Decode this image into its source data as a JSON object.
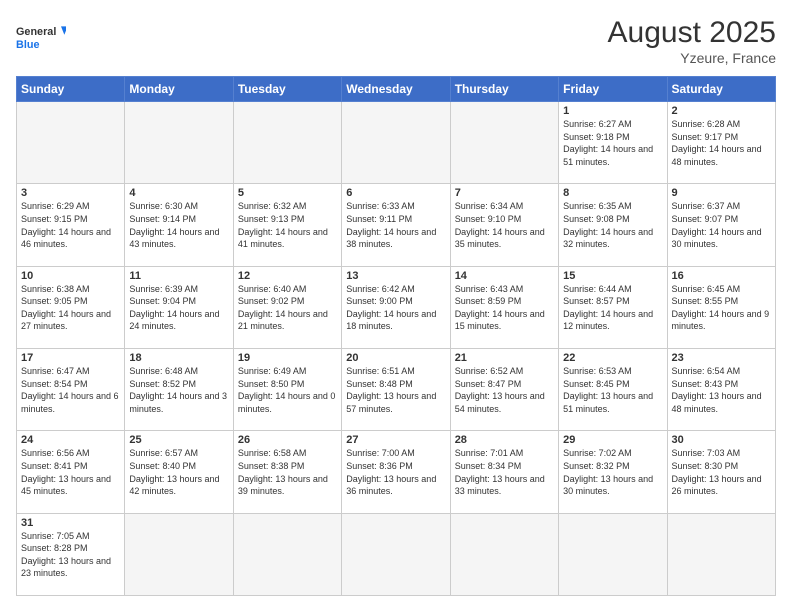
{
  "logo": {
    "text_general": "General",
    "text_blue": "Blue"
  },
  "header": {
    "title": "August 2025",
    "subtitle": "Yzeure, France"
  },
  "days_of_week": [
    "Sunday",
    "Monday",
    "Tuesday",
    "Wednesday",
    "Thursday",
    "Friday",
    "Saturday"
  ],
  "weeks": [
    [
      {
        "day": "",
        "info": ""
      },
      {
        "day": "",
        "info": ""
      },
      {
        "day": "",
        "info": ""
      },
      {
        "day": "",
        "info": ""
      },
      {
        "day": "",
        "info": ""
      },
      {
        "day": "1",
        "info": "Sunrise: 6:27 AM\nSunset: 9:18 PM\nDaylight: 14 hours and 51 minutes."
      },
      {
        "day": "2",
        "info": "Sunrise: 6:28 AM\nSunset: 9:17 PM\nDaylight: 14 hours and 48 minutes."
      }
    ],
    [
      {
        "day": "3",
        "info": "Sunrise: 6:29 AM\nSunset: 9:15 PM\nDaylight: 14 hours and 46 minutes."
      },
      {
        "day": "4",
        "info": "Sunrise: 6:30 AM\nSunset: 9:14 PM\nDaylight: 14 hours and 43 minutes."
      },
      {
        "day": "5",
        "info": "Sunrise: 6:32 AM\nSunset: 9:13 PM\nDaylight: 14 hours and 41 minutes."
      },
      {
        "day": "6",
        "info": "Sunrise: 6:33 AM\nSunset: 9:11 PM\nDaylight: 14 hours and 38 minutes."
      },
      {
        "day": "7",
        "info": "Sunrise: 6:34 AM\nSunset: 9:10 PM\nDaylight: 14 hours and 35 minutes."
      },
      {
        "day": "8",
        "info": "Sunrise: 6:35 AM\nSunset: 9:08 PM\nDaylight: 14 hours and 32 minutes."
      },
      {
        "day": "9",
        "info": "Sunrise: 6:37 AM\nSunset: 9:07 PM\nDaylight: 14 hours and 30 minutes."
      }
    ],
    [
      {
        "day": "10",
        "info": "Sunrise: 6:38 AM\nSunset: 9:05 PM\nDaylight: 14 hours and 27 minutes."
      },
      {
        "day": "11",
        "info": "Sunrise: 6:39 AM\nSunset: 9:04 PM\nDaylight: 14 hours and 24 minutes."
      },
      {
        "day": "12",
        "info": "Sunrise: 6:40 AM\nSunset: 9:02 PM\nDaylight: 14 hours and 21 minutes."
      },
      {
        "day": "13",
        "info": "Sunrise: 6:42 AM\nSunset: 9:00 PM\nDaylight: 14 hours and 18 minutes."
      },
      {
        "day": "14",
        "info": "Sunrise: 6:43 AM\nSunset: 8:59 PM\nDaylight: 14 hours and 15 minutes."
      },
      {
        "day": "15",
        "info": "Sunrise: 6:44 AM\nSunset: 8:57 PM\nDaylight: 14 hours and 12 minutes."
      },
      {
        "day": "16",
        "info": "Sunrise: 6:45 AM\nSunset: 8:55 PM\nDaylight: 14 hours and 9 minutes."
      }
    ],
    [
      {
        "day": "17",
        "info": "Sunrise: 6:47 AM\nSunset: 8:54 PM\nDaylight: 14 hours and 6 minutes."
      },
      {
        "day": "18",
        "info": "Sunrise: 6:48 AM\nSunset: 8:52 PM\nDaylight: 14 hours and 3 minutes."
      },
      {
        "day": "19",
        "info": "Sunrise: 6:49 AM\nSunset: 8:50 PM\nDaylight: 14 hours and 0 minutes."
      },
      {
        "day": "20",
        "info": "Sunrise: 6:51 AM\nSunset: 8:48 PM\nDaylight: 13 hours and 57 minutes."
      },
      {
        "day": "21",
        "info": "Sunrise: 6:52 AM\nSunset: 8:47 PM\nDaylight: 13 hours and 54 minutes."
      },
      {
        "day": "22",
        "info": "Sunrise: 6:53 AM\nSunset: 8:45 PM\nDaylight: 13 hours and 51 minutes."
      },
      {
        "day": "23",
        "info": "Sunrise: 6:54 AM\nSunset: 8:43 PM\nDaylight: 13 hours and 48 minutes."
      }
    ],
    [
      {
        "day": "24",
        "info": "Sunrise: 6:56 AM\nSunset: 8:41 PM\nDaylight: 13 hours and 45 minutes."
      },
      {
        "day": "25",
        "info": "Sunrise: 6:57 AM\nSunset: 8:40 PM\nDaylight: 13 hours and 42 minutes."
      },
      {
        "day": "26",
        "info": "Sunrise: 6:58 AM\nSunset: 8:38 PM\nDaylight: 13 hours and 39 minutes."
      },
      {
        "day": "27",
        "info": "Sunrise: 7:00 AM\nSunset: 8:36 PM\nDaylight: 13 hours and 36 minutes."
      },
      {
        "day": "28",
        "info": "Sunrise: 7:01 AM\nSunset: 8:34 PM\nDaylight: 13 hours and 33 minutes."
      },
      {
        "day": "29",
        "info": "Sunrise: 7:02 AM\nSunset: 8:32 PM\nDaylight: 13 hours and 30 minutes."
      },
      {
        "day": "30",
        "info": "Sunrise: 7:03 AM\nSunset: 8:30 PM\nDaylight: 13 hours and 26 minutes."
      }
    ],
    [
      {
        "day": "31",
        "info": "Sunrise: 7:05 AM\nSunset: 8:28 PM\nDaylight: 13 hours and 23 minutes."
      },
      {
        "day": "",
        "info": ""
      },
      {
        "day": "",
        "info": ""
      },
      {
        "day": "",
        "info": ""
      },
      {
        "day": "",
        "info": ""
      },
      {
        "day": "",
        "info": ""
      },
      {
        "day": "",
        "info": ""
      }
    ]
  ]
}
